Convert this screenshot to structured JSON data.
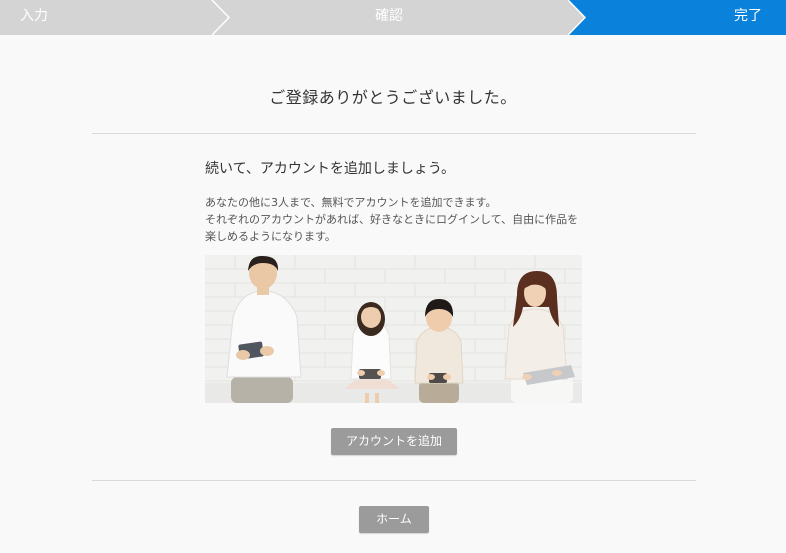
{
  "steps": [
    {
      "label": "入力",
      "state": "done"
    },
    {
      "label": "確認",
      "state": "done"
    },
    {
      "label": "完了",
      "state": "current"
    }
  ],
  "colors": {
    "step_inactive": "#d4d4d4",
    "step_active": "#0a82dc",
    "button": "#9b9b9b",
    "background": "#f9f9f9"
  },
  "page": {
    "title": "ご登録ありがとうございました。",
    "subheading": "続いて、アカウントを追加しましょう。",
    "description": [
      "あなたの他に3人まで、無料でアカウントを追加できます。",
      "それぞれのアカウントがあれば、好きなときにログインして、自由に作品を",
      "楽しめるようになります。"
    ]
  },
  "buttons": {
    "add_account": "アカウントを追加",
    "home": "ホーム"
  }
}
